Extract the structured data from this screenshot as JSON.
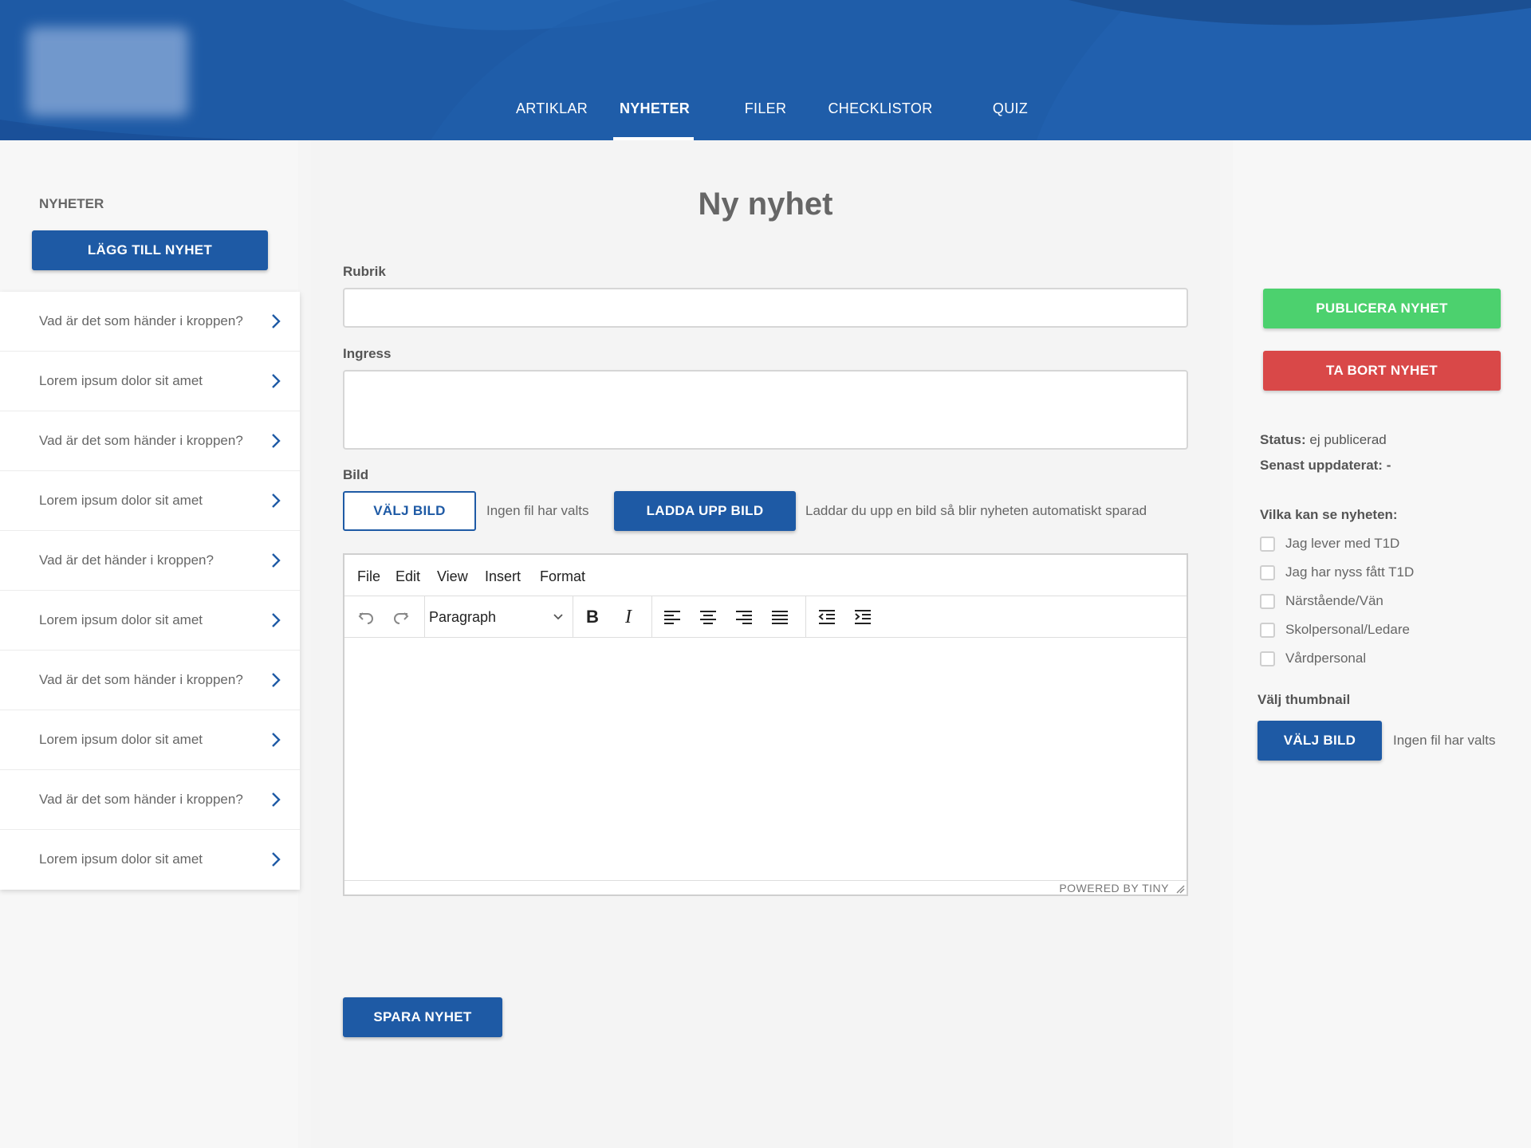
{
  "header": {
    "nav": [
      {
        "label": "ARTIKLAR"
      },
      {
        "label": "NYHETER"
      },
      {
        "label": "FILER"
      },
      {
        "label": "CHECKLISTOR"
      },
      {
        "label": "QUIZ"
      }
    ],
    "active_nav": "NYHETER"
  },
  "sidebar": {
    "title": "NYHETER",
    "add_button": "LÄGG TILL NYHET",
    "items": [
      {
        "label": "Vad är det som händer i kroppen?"
      },
      {
        "label": "Lorem ipsum dolor sit amet"
      },
      {
        "label": "Vad är det som händer i kroppen?"
      },
      {
        "label": "Lorem ipsum dolor sit amet"
      },
      {
        "label": "Vad är det händer i kroppen?"
      },
      {
        "label": "Lorem ipsum dolor sit amet"
      },
      {
        "label": "Vad är det som händer i kroppen?"
      },
      {
        "label": "Lorem ipsum dolor sit amet"
      },
      {
        "label": "Vad är det som händer i kroppen?"
      },
      {
        "label": "Lorem ipsum dolor sit amet"
      }
    ]
  },
  "main": {
    "title": "Ny nyhet",
    "rubrik_label": "Rubrik",
    "rubrik_value": "",
    "ingress_label": "Ingress",
    "ingress_value": "",
    "bild_label": "Bild",
    "choose_image_button": "VÄLJ BILD",
    "no_file_text": "Ingen fil har valts",
    "upload_button": "LADDA UPP BILD",
    "upload_hint": "Laddar du upp en bild så blir nyheten automatiskt sparad",
    "editor": {
      "menu": [
        "File",
        "Edit",
        "View",
        "Insert",
        "Format"
      ],
      "block_format": "Paragraph",
      "powered_by": "POWERED BY TINY"
    },
    "save_button": "SPARA NYHET"
  },
  "right": {
    "publish_button": "PUBLICERA NYHET",
    "delete_button": "TA BORT NYHET",
    "status_label": "Status:",
    "status_value": "ej publicerad",
    "updated_label": "Senast uppdaterat:",
    "updated_value": "-",
    "visibility_label": "Vilka kan se nyheten:",
    "audiences": [
      {
        "label": "Jag lever med T1D",
        "checked": false
      },
      {
        "label": "Jag har nyss fått T1D",
        "checked": false
      },
      {
        "label": "Närstående/Vän",
        "checked": false
      },
      {
        "label": "Skolpersonal/Ledare",
        "checked": false
      },
      {
        "label": "Vårdpersonal",
        "checked": false
      }
    ],
    "thumbnail_label": "Välj thumbnail",
    "thumbnail_button": "VÄLJ BILD",
    "thumbnail_no_file": "Ingen fil har valts"
  },
  "colors": {
    "brand_blue": "#1e5aa5",
    "publish_green": "#4cd16e",
    "delete_red": "#d94848"
  }
}
